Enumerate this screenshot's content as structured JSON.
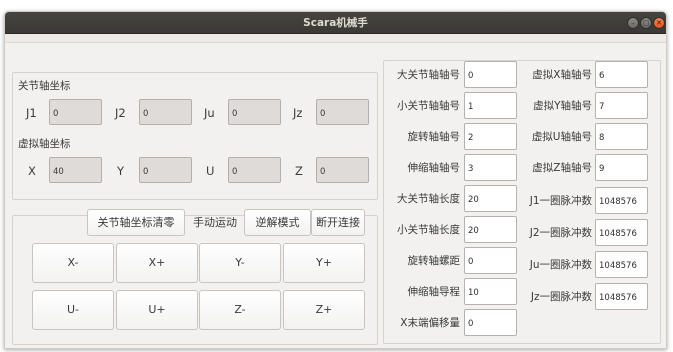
{
  "window": {
    "title": "Scara机械手",
    "controls": [
      "minimize-icon",
      "maximize-icon",
      "close-icon"
    ]
  },
  "joint_coords": {
    "title": "关节轴坐标",
    "fields": [
      {
        "label": "J1",
        "value": "0"
      },
      {
        "label": "J2",
        "value": "0"
      },
      {
        "label": "Ju",
        "value": "0"
      },
      {
        "label": "Jz",
        "value": "0"
      }
    ]
  },
  "virtual_coords": {
    "title": "虚拟轴坐标",
    "fields": [
      {
        "label": "X",
        "value": "40"
      },
      {
        "label": "Y",
        "value": "0"
      },
      {
        "label": "U",
        "value": "0"
      },
      {
        "label": "Z",
        "value": "0"
      }
    ]
  },
  "toolbar": {
    "clear_label": "关节轴坐标清零",
    "manual_label": "手动运动",
    "inverse_label": "逆解模式",
    "disconnect_label": "断开连接"
  },
  "jog": {
    "row1": [
      "X-",
      "X+",
      "Y-",
      "Y+"
    ],
    "row2": [
      "U-",
      "U+",
      "Z-",
      "Z+"
    ]
  },
  "params": {
    "left": [
      {
        "label": "大关节轴轴号",
        "value": "0"
      },
      {
        "label": "小关节轴轴号",
        "value": "1"
      },
      {
        "label": "旋转轴轴号",
        "value": "2"
      },
      {
        "label": "伸缩轴轴号",
        "value": "3"
      },
      {
        "label": "大关节轴长度",
        "value": "20"
      },
      {
        "label": "小关节轴长度",
        "value": "20"
      },
      {
        "label": "旋转轴螺距",
        "value": "0"
      },
      {
        "label": "伸缩轴导程",
        "value": "10"
      },
      {
        "label": "X末端偏移量",
        "value": "0"
      }
    ],
    "right": [
      {
        "label": "虚拟X轴轴号",
        "value": "6"
      },
      {
        "label": "虚拟Y轴轴号",
        "value": "7"
      },
      {
        "label": "虚拟U轴轴号",
        "value": "8"
      },
      {
        "label": "虚拟Z轴轴号",
        "value": "9"
      },
      {
        "label": "J1一圈脉冲数",
        "value": "1048576"
      },
      {
        "label": "J2一圈脉冲数",
        "value": "1048576"
      },
      {
        "label": "Ju一圈脉冲数",
        "value": "1048576"
      },
      {
        "label": "Jz一圈脉冲数",
        "value": "1048576"
      }
    ]
  }
}
